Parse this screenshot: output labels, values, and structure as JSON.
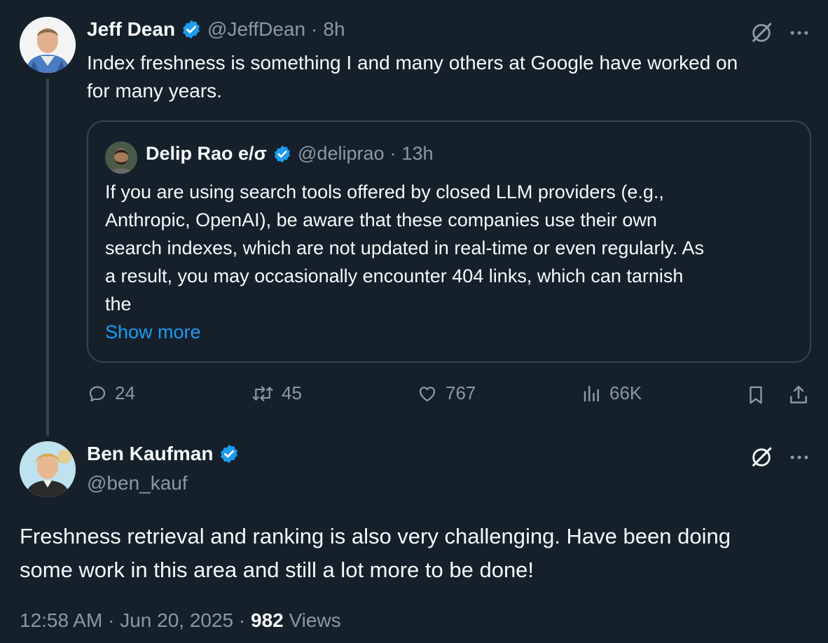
{
  "tweet1": {
    "author_name": "Jeff Dean",
    "handle": "@JeffDean",
    "separator": "·",
    "time": "8h",
    "text_line1": "Index freshness is something I and many others at Google have worked on",
    "text_line2": "for many years.",
    "quote": {
      "author_name": "Delip Rao e/σ",
      "handle": "@deliprao",
      "separator": "·",
      "time": "13h",
      "lines": [
        "If you are using search tools offered by closed LLM providers (e.g.,",
        "Anthropic, OpenAI), be aware that these companies use their own",
        "search indexes, which are not updated in real-time or even regularly. As",
        "a result, you may occasionally encounter 404 links, which can tarnish",
        "the"
      ],
      "show_more": "Show more"
    },
    "actions": {
      "replies": "24",
      "reposts": "45",
      "likes": "767",
      "views": "66K"
    }
  },
  "tweet2": {
    "author_name": "Ben Kaufman",
    "handle": "@ben_kauf",
    "text_line1": "Freshness retrieval and ranking is also very challenging. Have been doing",
    "text_line2": "some work in this area and still a lot more to be done!",
    "footer": {
      "time": "12:58 AM",
      "separator": "·",
      "date": "Jun 20, 2025",
      "separator2": "·",
      "views_count": "982",
      "views_label": "Views"
    }
  },
  "colors": {
    "background": "#15202b",
    "text": "#f7f9f9",
    "muted": "#8b98a5",
    "accent": "#1d9bf0",
    "border": "#38444d"
  },
  "icons": [
    "verified-badge-icon",
    "grok-icon",
    "more-icon",
    "reply-icon",
    "repost-icon",
    "like-icon",
    "views-icon",
    "bookmark-icon",
    "share-icon"
  ]
}
